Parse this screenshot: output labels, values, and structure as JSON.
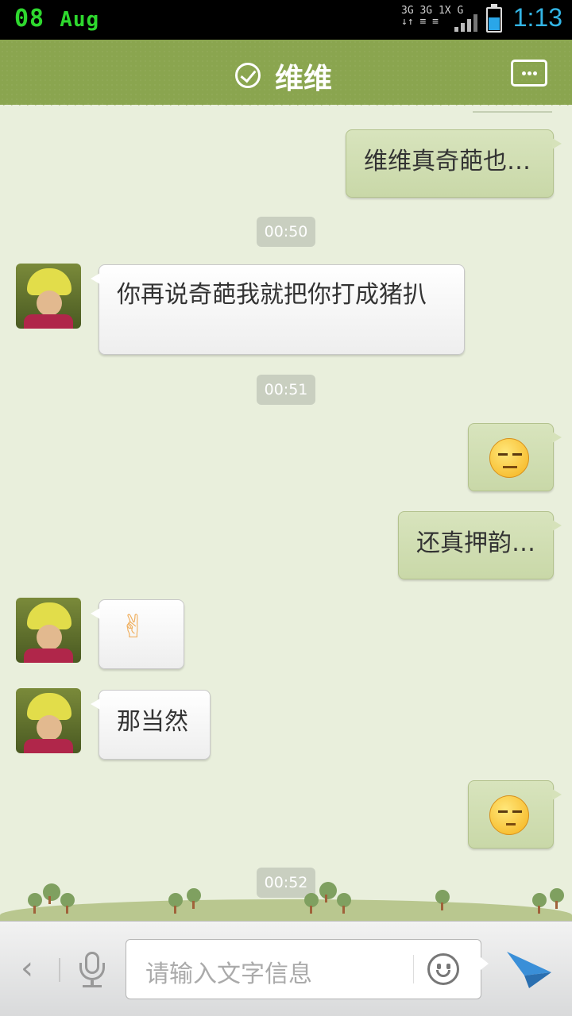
{
  "status_bar": {
    "date_day": "08",
    "date_month": "Aug",
    "network_line1": "3G 3G 1X G",
    "network_line2": "↓↑ ≡ ≡",
    "time": "1:13",
    "battery_color": "#2aa6e8"
  },
  "header": {
    "title": "维维",
    "verified_icon": "check-circle-icon",
    "menu_icon": "chat-menu-icon",
    "bg_color": "#8aa54f"
  },
  "messages": [
    {
      "side": "out",
      "type": "text",
      "text": "维维真奇葩也…"
    },
    {
      "type": "timestamp",
      "text": "00:50"
    },
    {
      "side": "in",
      "type": "text",
      "text": "你再说奇葩我就把你打成猪扒"
    },
    {
      "type": "timestamp",
      "text": "00:51"
    },
    {
      "side": "out",
      "type": "emoji",
      "emoji": "sweat-face-icon"
    },
    {
      "side": "out",
      "type": "text",
      "text": "还真押韵…"
    },
    {
      "side": "in",
      "type": "emoji",
      "emoji": "victory-hand-icon"
    },
    {
      "side": "in",
      "type": "text",
      "text": "那当然"
    },
    {
      "side": "out",
      "type": "emoji",
      "emoji": "tease-face-icon"
    },
    {
      "type": "timestamp",
      "text": "00:52"
    }
  ],
  "input_bar": {
    "placeholder": "请输入文字信息",
    "back_icon": "chevron-left-icon",
    "voice_icon": "microphone-icon",
    "emoji_icon": "smiley-icon",
    "send_icon": "paper-plane-send-icon",
    "send_color": "#3a8fd8"
  }
}
